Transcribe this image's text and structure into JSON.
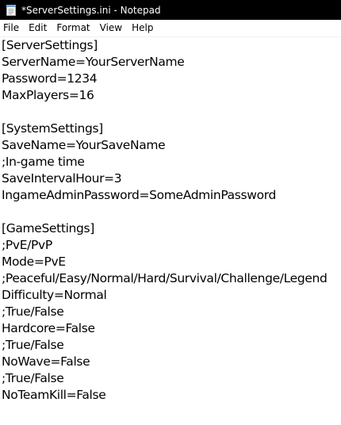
{
  "window": {
    "title": "*ServerSettings.ini - Notepad",
    "titlebar_color": "#000000"
  },
  "menu": {
    "items": [
      {
        "label": "File"
      },
      {
        "label": "Edit"
      },
      {
        "label": "Format"
      },
      {
        "label": "View"
      },
      {
        "label": "Help"
      }
    ]
  },
  "editor": {
    "lines": [
      "[ServerSettings]",
      "ServerName=YourServerName",
      "Password=1234",
      "MaxPlayers=16",
      "",
      "[SystemSettings]",
      "SaveName=YourSaveName",
      ";In-game time",
      "SaveIntervalHour=3",
      "IngameAdminPassword=SomeAdminPassword",
      "",
      "[GameSettings]",
      ";PvE/PvP",
      "Mode=PvE",
      ";Peaceful/Easy/Normal/Hard/Survival/Challenge/Legend",
      "Difficulty=Normal",
      ";True/False",
      "Hardcore=False",
      ";True/False",
      "NoWave=False",
      ";True/False",
      "NoTeamKill=False"
    ]
  }
}
